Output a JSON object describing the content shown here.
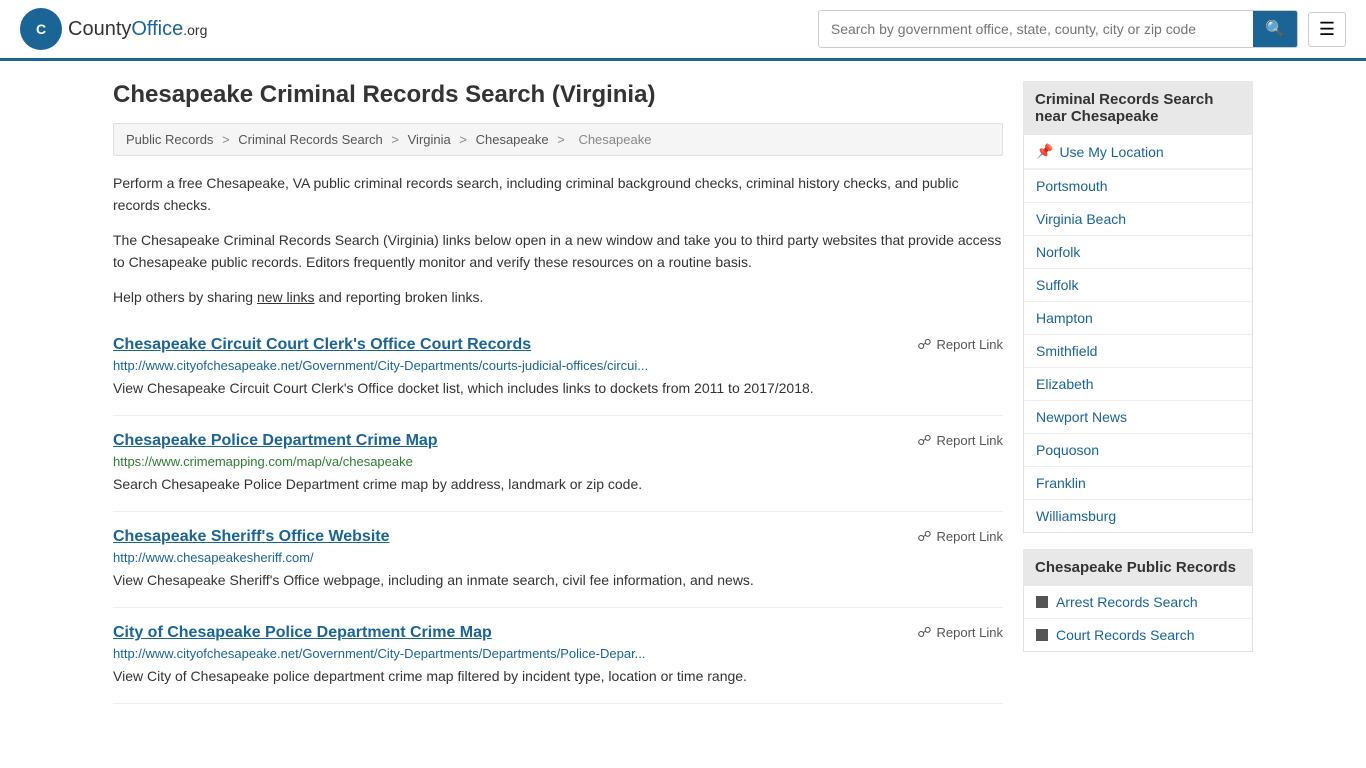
{
  "header": {
    "logo_text": "CountyOffice",
    "logo_org": ".org",
    "search_placeholder": "Search by government office, state, county, city or zip code"
  },
  "page": {
    "title": "Chesapeake Criminal Records Search (Virginia)",
    "breadcrumb": [
      "Public Records",
      "Criminal Records Search",
      "Virginia",
      "Chesapeake",
      "Chesapeake"
    ],
    "description1": "Perform a free Chesapeake, VA public criminal records search, including criminal background checks, criminal history checks, and public records checks.",
    "description2": "The Chesapeake Criminal Records Search (Virginia) links below open in a new window and take you to third party websites that provide access to Chesapeake public records. Editors frequently monitor and verify these resources on a routine basis.",
    "description3": "Help others by sharing",
    "description3_link": "new links",
    "description3_end": "and reporting broken links."
  },
  "results": [
    {
      "title": "Chesapeake Circuit Court Clerk's Office Court Records",
      "url": "http://www.cityofchesapeake.net/Government/City-Departments/courts-judicial-offices/circui...",
      "url_color": "blue",
      "desc": "View Chesapeake Circuit Court Clerk's Office docket list, which includes links to dockets from 2011 to 2017/2018.",
      "report": "Report Link"
    },
    {
      "title": "Chesapeake Police Department Crime Map",
      "url": "https://www.crimemapping.com/map/va/chesapeake",
      "url_color": "green",
      "desc": "Search Chesapeake Police Department crime map by address, landmark or zip code.",
      "report": "Report Link"
    },
    {
      "title": "Chesapeake Sheriff's Office Website",
      "url": "http://www.chesapeakesheriff.com/",
      "url_color": "blue",
      "desc": "View Chesapeake Sheriff's Office webpage, including an inmate search, civil fee information, and news.",
      "report": "Report Link"
    },
    {
      "title": "City of Chesapeake Police Department Crime Map",
      "url": "http://www.cityofchesapeake.net/Government/City-Departments/Departments/Police-Depar...",
      "url_color": "blue",
      "desc": "View City of Chesapeake police department crime map filtered by incident type, location or time range.",
      "report": "Report Link"
    }
  ],
  "sidebar": {
    "nearby_header": "Criminal Records Search near Chesapeake",
    "use_location": "Use My Location",
    "nearby_cities": [
      "Portsmouth",
      "Virginia Beach",
      "Norfolk",
      "Suffolk",
      "Hampton",
      "Smithfield",
      "Elizabeth",
      "Newport News",
      "Poquoson",
      "Franklin",
      "Williamsburg"
    ],
    "public_records_header": "Chesapeake Public Records",
    "public_records_links": [
      "Arrest Records Search",
      "Court Records Search"
    ]
  }
}
